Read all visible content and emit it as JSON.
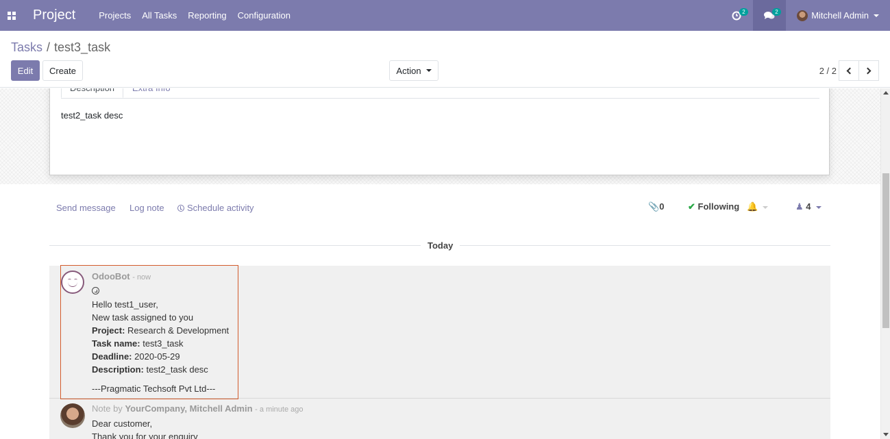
{
  "navbar": {
    "app_name": "Project",
    "menu": [
      "Projects",
      "All Tasks",
      "Reporting",
      "Configuration"
    ],
    "activity_count": "2",
    "message_count": "2",
    "user_name": "Mitchell Admin"
  },
  "breadcrumb": {
    "parent": "Tasks",
    "separator": "/",
    "current": "test3_task"
  },
  "buttons": {
    "edit": "Edit",
    "create": "Create",
    "action": "Action"
  },
  "pager": {
    "value": "2 / 2"
  },
  "tabs": [
    "Description",
    "Extra Info"
  ],
  "description_text": "test2_task desc",
  "chatter": {
    "send_message": "Send message",
    "log_note": "Log note",
    "schedule_activity": "Schedule activity",
    "attachments": "0",
    "following": "Following",
    "followers": "4",
    "divider": "Today"
  },
  "messages": [
    {
      "author": "OdooBot",
      "date": "- now",
      "lines": {
        "greeting": "Hello test1_user,",
        "intro": "New task assigned to you",
        "project_label": "Project:",
        "project_value": "Research & Development",
        "task_label": "Task name:",
        "task_value": "test3_task",
        "deadline_label": "Deadline:",
        "deadline_value": "2020-05-29",
        "desc_label": "Description:",
        "desc_value": "test2_task desc",
        "signature": "---Pragmatic Techsoft Pvt Ltd---"
      }
    },
    {
      "prefix": "Note by",
      "author": "YourCompany, Mitchell Admin",
      "date": "- a minute ago",
      "lines": {
        "salutation": "Dear customer,",
        "body": "Thank you for your enquiry"
      }
    }
  ],
  "colors": {
    "brand": "#7c7bad",
    "highlight_border": "#d35b2b",
    "success": "#28a745"
  }
}
